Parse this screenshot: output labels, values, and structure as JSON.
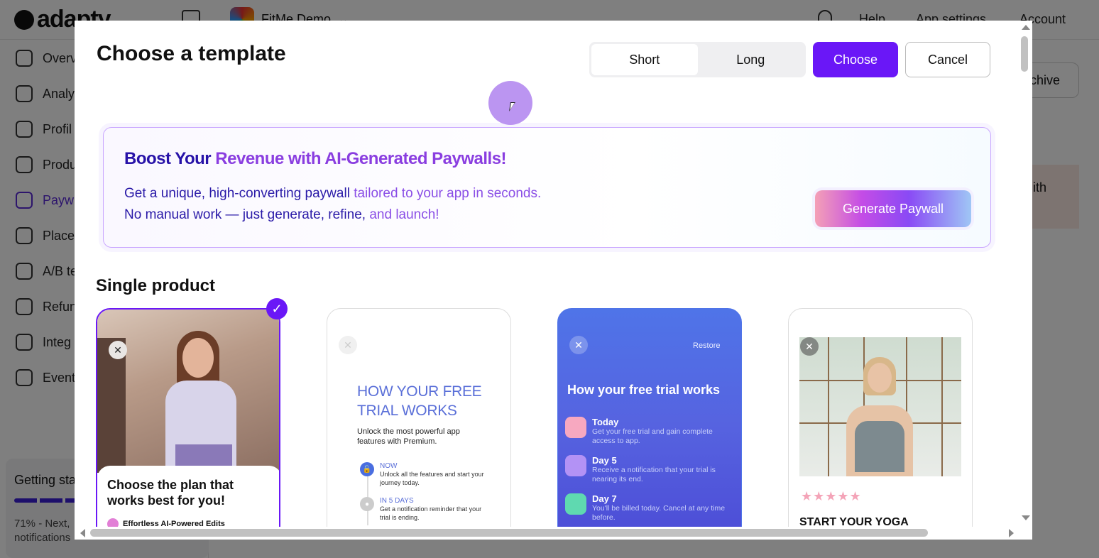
{
  "background": {
    "logo": "adapty",
    "app_name": "FitMe Demo",
    "top_links": [
      "Help",
      "App settings",
      "Account"
    ],
    "nav_items": [
      "Overv",
      "Analy",
      "Profil",
      "Produ",
      "Payw",
      "Place",
      "A/B te",
      "Refun",
      "Integ",
      "Event"
    ],
    "getting_started_title": "Getting sta",
    "getting_started_line1": "71% - Next,",
    "getting_started_line2": "notifications",
    "archive_button": "chive",
    "right_text": "ith"
  },
  "modal": {
    "title": "Choose a template",
    "segments": [
      "Short",
      "Long"
    ],
    "active_segment": "Short",
    "choose_label": "Choose",
    "cancel_label": "Cancel"
  },
  "promo": {
    "title_part1": "Boost Your",
    "title_part2": "Revenue with AI-Generated Paywalls!",
    "line1_part1": "Get a unique, high-converting paywall",
    "line1_part2": "tailored to your app in seconds.",
    "line2_part1": "No manual work — just generate, refine,",
    "line2_part2": "and launch!",
    "button_label": "Generate Paywall"
  },
  "section_title": "Single product",
  "cards": [
    {
      "title": "Choose the plan that works best for you!",
      "feature": "Effortless AI-Powered Edits"
    },
    {
      "title_line1": "HOW YOUR FREE",
      "title_line2": "TRIAL WORKS",
      "subtitle": "Unlock the most powerful app features with Premium.",
      "steps": [
        {
          "heading": "NOW",
          "desc": "Unlock all the features and start your journey today."
        },
        {
          "heading": "IN 5 DAYS",
          "desc": "Get a notification reminder that your trial is ending."
        }
      ]
    },
    {
      "restore": "Restore",
      "title": "How your free trial works",
      "steps": [
        {
          "heading": "Today",
          "desc": "Get your free trial and gain complete access to app."
        },
        {
          "heading": "Day 5",
          "desc": "Receive a notification that your trial is nearing its end."
        },
        {
          "heading": "Day 7",
          "desc": "You'll be billed today. Cancel at any time before."
        }
      ]
    },
    {
      "stars": "★★★★★",
      "title": "START YOUR YOGA"
    }
  ],
  "colors": {
    "accent": "#6a17f7",
    "promo_dark": "#2712a8",
    "promo_light": "#8a3ee0"
  }
}
